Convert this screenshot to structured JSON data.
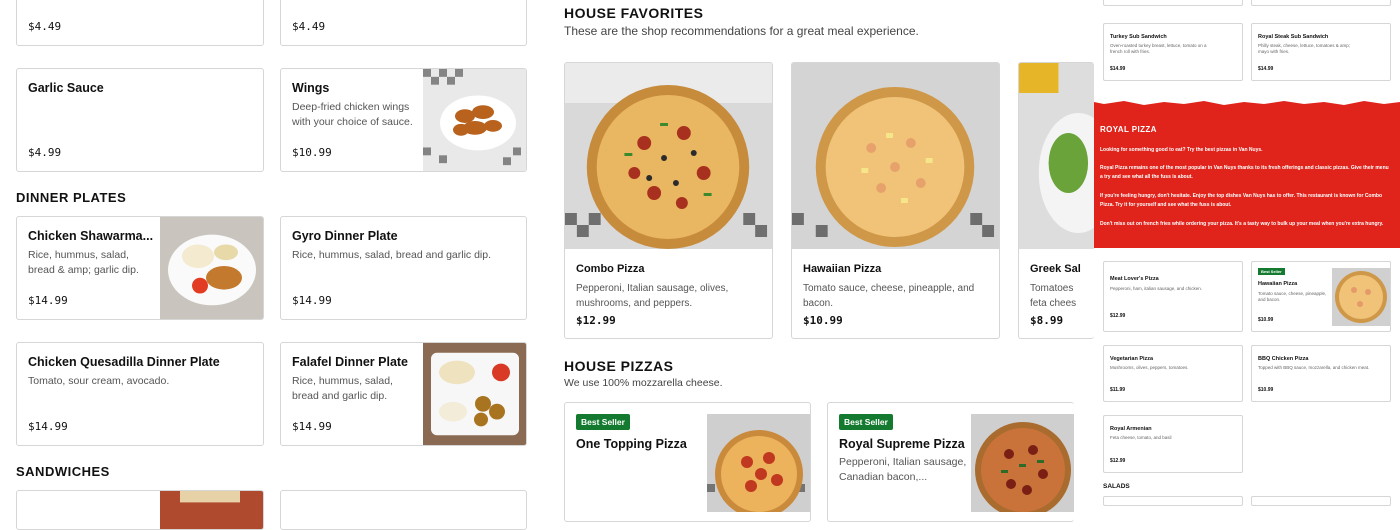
{
  "top_items": [
    {
      "price": "$4.49"
    },
    {
      "price": "$4.49"
    }
  ],
  "extras": [
    {
      "title": "Garlic Sauce",
      "desc": "",
      "price": "$4.99"
    },
    {
      "title": "Wings",
      "desc_line1": "Deep-fried chicken wings",
      "desc_line2": "with your choice of sauce.",
      "price": "$10.99"
    }
  ],
  "dinner_plates": {
    "heading": "DINNER PLATES",
    "items": [
      {
        "title": "Chicken Shawarma...",
        "desc_line1": "Rice, hummus, salad,",
        "desc_line2": "bread & amp; garlic dip.",
        "price": "$14.99"
      },
      {
        "title": "Gyro Dinner Plate",
        "desc_line1": "Rice, hummus, salad, bread and garlic dip.",
        "desc_line2": "",
        "price": "$14.99"
      },
      {
        "title": "Chicken Quesadilla Dinner Plate",
        "desc_line1": "Tomato, sour cream, avocado.",
        "desc_line2": "",
        "price": "$14.99"
      },
      {
        "title": "Falafel Dinner Plate",
        "desc_line1": "Rice, hummus, salad,",
        "desc_line2": "bread and garlic dip.",
        "price": "$14.99"
      }
    ]
  },
  "sandwiches": {
    "heading": "SANDWICHES"
  },
  "house_favorites": {
    "heading": "HOUSE FAVORITES",
    "subtitle": "These are the shop recommendations for a great meal experience.",
    "items": [
      {
        "title": "Combo Pizza",
        "desc_line1": "Pepperoni, Italian sausage, olives,",
        "desc_line2": "mushrooms, and peppers.",
        "price": "$12.99"
      },
      {
        "title": "Hawaiian Pizza",
        "desc_line1": "Tomato sauce, cheese, pineapple, and",
        "desc_line2": "bacon.",
        "price": "$10.99"
      },
      {
        "title": "Greek Sal",
        "desc_line1": "Tomatoes",
        "desc_line2": "feta chees",
        "price": "$8.99"
      }
    ]
  },
  "house_pizzas": {
    "heading": "HOUSE PIZZAS",
    "subtitle": "We use 100% mozzarella cheese.",
    "items": [
      {
        "badge": "Best Seller",
        "title": "One Topping Pizza",
        "desc_line1": "",
        "desc_line2": ""
      },
      {
        "badge": "Best Seller",
        "title": "Royal Supreme Pizza",
        "desc_line1": "Pepperoni, Italian sausage,",
        "desc_line2": "Canadian bacon,..."
      }
    ]
  },
  "mobile_preview": {
    "sandwich_cards": [
      {
        "title": "Turkey Sub Sandwich",
        "desc_line1": "Oven-roasted turkey breast, lettuce, tomato on a",
        "desc_line2": "french roll with fries.",
        "price": "$14.99"
      },
      {
        "title": "Royal Steak Sub Sandwich",
        "desc_line1": "Philly steak, cheese, lettuce, tomatoes & amp;",
        "desc_line2": "mayo with fries.",
        "price": "$14.99"
      }
    ],
    "banner": {
      "title": "ROYAL PIZZA",
      "p1": "Looking for something good to eat? Try the best pizzas in Van Nuys.",
      "p2": "Royal Pizza remains one of the most popular in Van Nuys thanks to its fresh offerings and classic pizzas. Give their menu a try and see what all the fuss is about.",
      "p3": "If you're feeling hungry, don't hesitate. Enjoy the top dishes Van Nuys has to offer. This restaurant is known for Combo Pizza. Try it for yourself and see what the fuss is about.",
      "p4": "Don't miss out on french fries while ordering your pizza. It's a tasty way to bulk up your meal when you're extra hungry."
    },
    "pizza_cards": [
      {
        "title": "Meat Lover's Pizza",
        "desc": "Pepperoni, ham, italian sausage, and chicken.",
        "price": "$12.99",
        "badge": ""
      },
      {
        "title": "Hawaiian Pizza",
        "desc": "Tomato sauce, cheese, pineapple, and bacon.",
        "price": "$10.99",
        "badge": "Best Seller"
      },
      {
        "title": "Vegetarian Pizza",
        "desc": "Mushrooms, olives, peppers, tomatoes.",
        "price": "$11.99",
        "badge": ""
      },
      {
        "title": "BBQ Chicken Pizza",
        "desc": "Topped with BBQ sauce, mozzarella, and chicken meat.",
        "price": "$10.99",
        "badge": ""
      },
      {
        "title": "Royal Armenian",
        "desc": "Feta cheese, tomato, and basil",
        "price": "$12.99",
        "badge": ""
      }
    ],
    "salads_heading": "SALADS"
  },
  "colors": {
    "accent_red": "#e0241c",
    "badge_green": "#137a2f"
  }
}
